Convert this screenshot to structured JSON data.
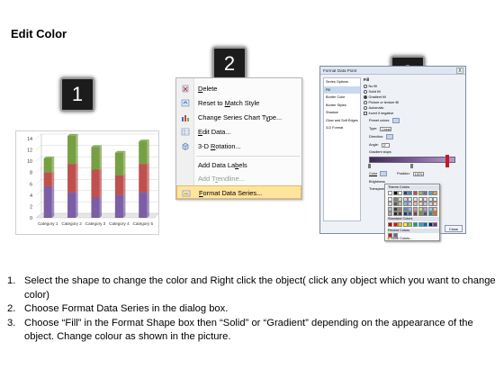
{
  "page": {
    "title": "Edit Color"
  },
  "badges": [
    "1",
    "2",
    "3"
  ],
  "chart_data": {
    "type": "bar",
    "stacked": true,
    "categories": [
      "Category 1",
      "Category 2",
      "Category 3",
      "Category 4",
      "Category 5"
    ],
    "series": [
      {
        "color": "#7b5ea7",
        "values": [
          5.5,
          4.5,
          3.5,
          4.0,
          4.5
        ]
      },
      {
        "color": "#c0504d",
        "values": [
          2.5,
          5.0,
          5.0,
          3.5,
          5.0
        ]
      },
      {
        "color": "#77a043",
        "values": [
          2.5,
          5.0,
          4.0,
          4.0,
          4.0
        ]
      }
    ],
    "ylim": [
      0,
      14
    ],
    "yticks": [
      "0",
      "2",
      "4",
      "6",
      "8",
      "10",
      "12",
      "14"
    ],
    "grid": true
  },
  "context_menu": {
    "items": [
      {
        "icon": "delete-icon",
        "label": "Delete",
        "underline": "D",
        "rest": "elete",
        "disabled": false
      },
      {
        "icon": "reset-style-icon",
        "label": "Reset to Match Style",
        "pre": "Reset to ",
        "underline": "M",
        "rest": "atch Style",
        "disabled": false
      },
      {
        "icon": "chart-type-icon",
        "label": "Change Series Chart Type...",
        "pre": "Change Series Chart T",
        "underline": "y",
        "rest": "pe...",
        "disabled": false
      },
      {
        "icon": "edit-data-icon",
        "label": "Edit Data...",
        "underline": "E",
        "rest": "dit Data...",
        "disabled": false
      },
      {
        "icon": "rotation-3d-icon",
        "label": "3-D Rotation...",
        "pre": "3-D ",
        "underline": "R",
        "rest": "otation...",
        "disabled": false
      },
      {
        "icon": "",
        "label": "Add Data Labels",
        "pre": "Add Data La",
        "underline": "b",
        "rest": "els",
        "disabled": false
      },
      {
        "icon": "",
        "label": "Add Trendline...",
        "pre": "Add T",
        "underline": "r",
        "rest": "endline...",
        "disabled": true
      },
      {
        "icon": "format-series-icon",
        "label": "Format Data Series...",
        "underline": "F",
        "rest": "ormat Data Series...",
        "disabled": false,
        "highlighted": true
      }
    ]
  },
  "dialog": {
    "title": "Format Data Point",
    "close": "X",
    "left_items": [
      "Series Options",
      "Fill",
      "Border Color",
      "Border Styles",
      "Shadow",
      "Glow and Soft Edges",
      "3-D Format"
    ],
    "selected_left": "Fill",
    "section_label": "Fill",
    "fill_options": [
      "No fill",
      "Solid fill",
      "Gradient fill",
      "Picture or texture fill",
      "Automatic",
      "Invert if negative"
    ],
    "preset_label": "Preset colors:",
    "type_label": "Type:",
    "type_value": "Linear",
    "direction_label": "Direction:",
    "angle_label": "Angle:",
    "angle_value": "0°",
    "gradient_stops_label": "Gradient stops",
    "color_label": "Color",
    "position_label": "Position:",
    "position_value": "100%",
    "brightness_label": "Brightness",
    "transparency_label": "Transparency",
    "close_button": "Close"
  },
  "picker": {
    "theme_label": "Theme Colors",
    "standard_label": "Standard Colors",
    "recent_label": "Recent Colors",
    "more": "More Colors...",
    "theme_top": [
      "#ffffff",
      "#000000",
      "#eeece1",
      "#1f497d",
      "#4f81bd",
      "#c0504d",
      "#9bbb59",
      "#8064a2",
      "#4bacc6",
      "#f79646"
    ],
    "theme_rows": [
      [
        "#f2f2f2",
        "#7f7f7f",
        "#ddd9c3",
        "#c6d9f0",
        "#dbe5f1",
        "#f2dcdb",
        "#ebf1dd",
        "#e5e0ec",
        "#dbeef3",
        "#fdeada"
      ],
      [
        "#d8d8d8",
        "#595959",
        "#c4bd97",
        "#8db3e2",
        "#b8cce4",
        "#e5b9b7",
        "#d7e3bc",
        "#ccc1d9",
        "#b7dde8",
        "#fbd5b5"
      ],
      [
        "#bfbfbf",
        "#3f3f3f",
        "#938953",
        "#548dd4",
        "#95b3d7",
        "#d99694",
        "#c3d69b",
        "#b2a2c7",
        "#92cddc",
        "#fac08f"
      ],
      [
        "#a5a5a5",
        "#262626",
        "#494429",
        "#17365d",
        "#366092",
        "#953734",
        "#76923c",
        "#5f497a",
        "#31859b",
        "#e36c09"
      ],
      [
        "#7f7f7f",
        "#0c0c0c",
        "#1d1b10",
        "#0f243e",
        "#244061",
        "#632423",
        "#4f6128",
        "#3f3151",
        "#205867",
        "#974806"
      ]
    ],
    "standard": [
      "#c00000",
      "#ff0000",
      "#ffc000",
      "#ffff00",
      "#92d050",
      "#00b050",
      "#00b0f0",
      "#0070c0",
      "#002060",
      "#7030a0"
    ],
    "recent": [
      "#c8181e",
      "#7b5ea7"
    ]
  },
  "instructions": [
    {
      "num": "1.",
      "text": "Select the shape to change the color and Right click the object( click any object which you want to change color)"
    },
    {
      "num": "2.",
      "text": "Choose Format Data Series in the dialog box."
    },
    {
      "num": "3.",
      "text": "Choose “Fill” in the Format Shape box then “Solid” or “Gradient” depending on the appearance of the object. Change colour as shown in the picture."
    }
  ]
}
